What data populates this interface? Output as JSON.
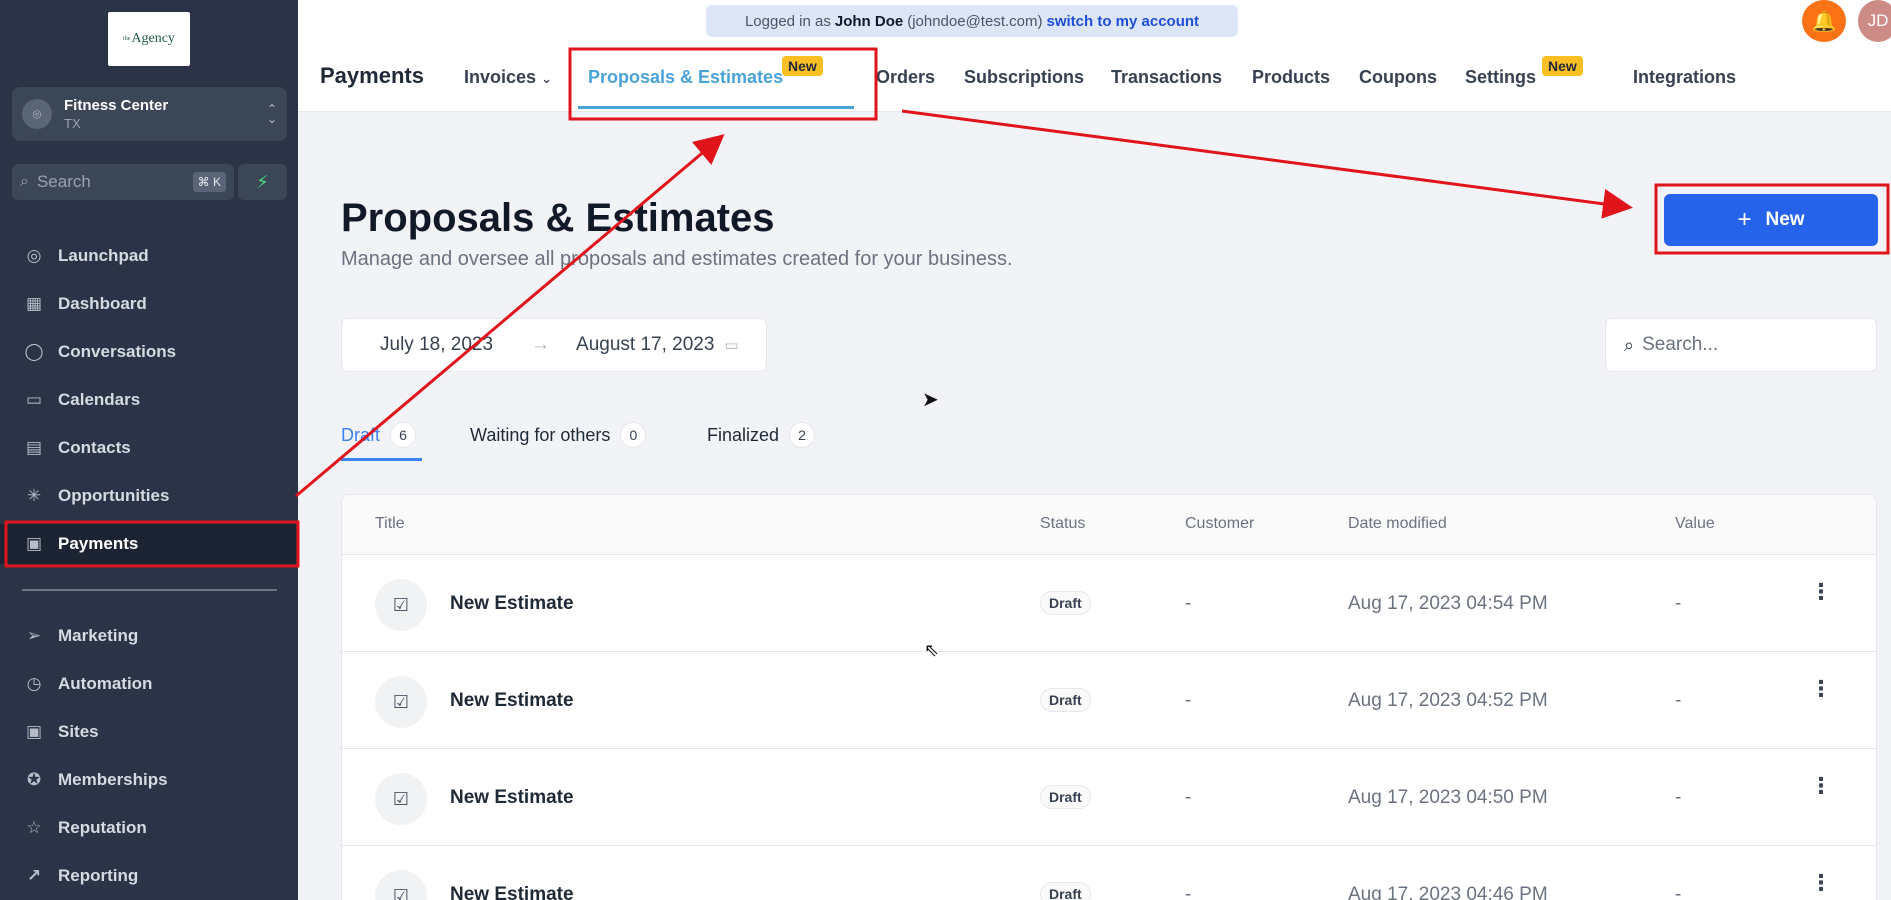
{
  "sidebar": {
    "logo_text": "Agency",
    "logo_small": "the",
    "account": {
      "name": "Fitness Center",
      "state": "TX"
    },
    "search": {
      "placeholder": "Search",
      "shortcut": "⌘ K"
    },
    "nav_items": [
      {
        "label": "Launchpad",
        "icon": "rocket-icon",
        "glyph": "◎"
      },
      {
        "label": "Dashboard",
        "icon": "dashboard-icon",
        "glyph": "▦"
      },
      {
        "label": "Conversations",
        "icon": "chat-icon",
        "glyph": "◯"
      },
      {
        "label": "Calendars",
        "icon": "calendar-icon",
        "glyph": "▭"
      },
      {
        "label": "Contacts",
        "icon": "contacts-icon",
        "glyph": "▤"
      },
      {
        "label": "Opportunities",
        "icon": "opportunities-icon",
        "glyph": "✳"
      },
      {
        "label": "Payments",
        "icon": "payments-icon",
        "glyph": "▣"
      }
    ],
    "nav_items_2": [
      {
        "label": "Marketing",
        "icon": "send-icon",
        "glyph": "➢"
      },
      {
        "label": "Automation",
        "icon": "automation-icon",
        "glyph": "◷"
      },
      {
        "label": "Sites",
        "icon": "sites-icon",
        "glyph": "▣"
      },
      {
        "label": "Memberships",
        "icon": "membership-icon",
        "glyph": "✪"
      },
      {
        "label": "Reputation",
        "icon": "star-icon",
        "glyph": "☆"
      },
      {
        "label": "Reporting",
        "icon": "chart-line-icon",
        "glyph": "↗"
      }
    ]
  },
  "topbar": {
    "login_prefix": "Logged in as",
    "login_user": "John Doe",
    "login_email": "(johndoe@test.com)",
    "login_switch": "switch to my account",
    "avatar_initials": "JD",
    "page_name": "Payments",
    "tabs": [
      "Invoices",
      "Proposals & Estimates",
      "Orders",
      "Subscriptions",
      "Transactions",
      "Products",
      "Coupons",
      "Settings",
      "Integrations"
    ],
    "badge_new": "New",
    "active_tab": "Proposals & Estimates"
  },
  "main": {
    "title": "Proposals & Estimates",
    "subtitle": "Manage and oversee all proposals and estimates created for your business.",
    "new_button": "New",
    "date_from": "July 18, 2023",
    "date_to": "August 17, 2023",
    "search_placeholder": "Search...",
    "status_tabs": [
      {
        "label": "Draft",
        "count": "6"
      },
      {
        "label": "Waiting for others",
        "count": "0"
      },
      {
        "label": "Finalized",
        "count": "2"
      }
    ],
    "columns": [
      "Title",
      "Status",
      "Customer",
      "Date modified",
      "Value"
    ],
    "rows": [
      {
        "title": "New Estimate",
        "status": "Draft",
        "customer": "-",
        "date": "Aug 17, 2023 04:54 PM",
        "value": "-"
      },
      {
        "title": "New Estimate",
        "status": "Draft",
        "customer": "-",
        "date": "Aug 17, 2023 04:52 PM",
        "value": "-"
      },
      {
        "title": "New Estimate",
        "status": "Draft",
        "customer": "-",
        "date": "Aug 17, 2023 04:50 PM",
        "value": "-"
      },
      {
        "title": "New Estimate",
        "status": "Draft",
        "customer": "-",
        "date": "Aug 17, 2023 04:46 PM",
        "value": "-"
      }
    ]
  },
  "colors": {
    "accent": "#2563eb",
    "tab_active": "#4aa3d8",
    "badge": "#fbbf24",
    "sidebar": "#2a3446",
    "annotation": "#e0141b"
  }
}
